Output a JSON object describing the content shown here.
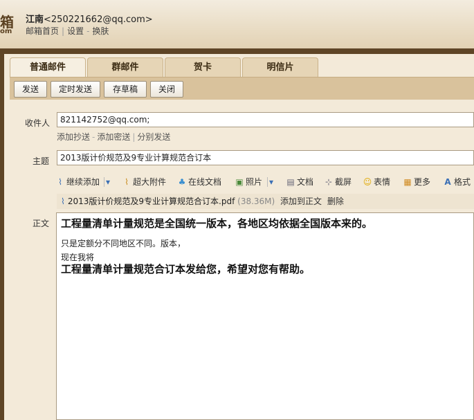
{
  "header": {
    "logo_char": "箱",
    "logo_sub": "om",
    "user_name": "江南",
    "user_email": "<250221662@qq.com>",
    "links": [
      "邮箱首页",
      "设置",
      "换肤"
    ]
  },
  "tabs": [
    {
      "label": "普通邮件",
      "active": true
    },
    {
      "label": "群邮件",
      "active": false
    },
    {
      "label": "贺卡",
      "active": false
    },
    {
      "label": "明信片",
      "active": false
    }
  ],
  "toolbar": {
    "send": "发送",
    "schedule": "定时发送",
    "draft": "存草稿",
    "close": "关闭"
  },
  "form": {
    "to_label": "收件人",
    "to_value": "821142752@qq.com;",
    "cc_link": "添加抄送",
    "bcc_link": "添加密送",
    "separate_link": "分别发送",
    "subject_label": "主题",
    "subject_value": "2013版计价规范及9专业计算规范合订本",
    "body_label": "正文"
  },
  "rich_toolbar": {
    "continue_add": "继续添加",
    "big_attach": "超大附件",
    "online_doc": "在线文档",
    "photo": "照片",
    "doc": "文档",
    "screenshot": "截屏",
    "emoji": "表情",
    "more": "更多",
    "format": "格式"
  },
  "attachment": {
    "filename": "2013版计价规范及9专业计算规范合订本.pdf",
    "size": "(38.36M)",
    "add_to_body": "添加到正文",
    "delete": "删除"
  },
  "body": {
    "line1": "工程量清单计量规范是全国统一版本，各地区均依据全国版本来的。",
    "line2": "只是定额分不同地区不同。版本，",
    "line3": "现在我将",
    "line4": "工程量清单计量规范合订本发给您，希望对您有帮助。"
  }
}
